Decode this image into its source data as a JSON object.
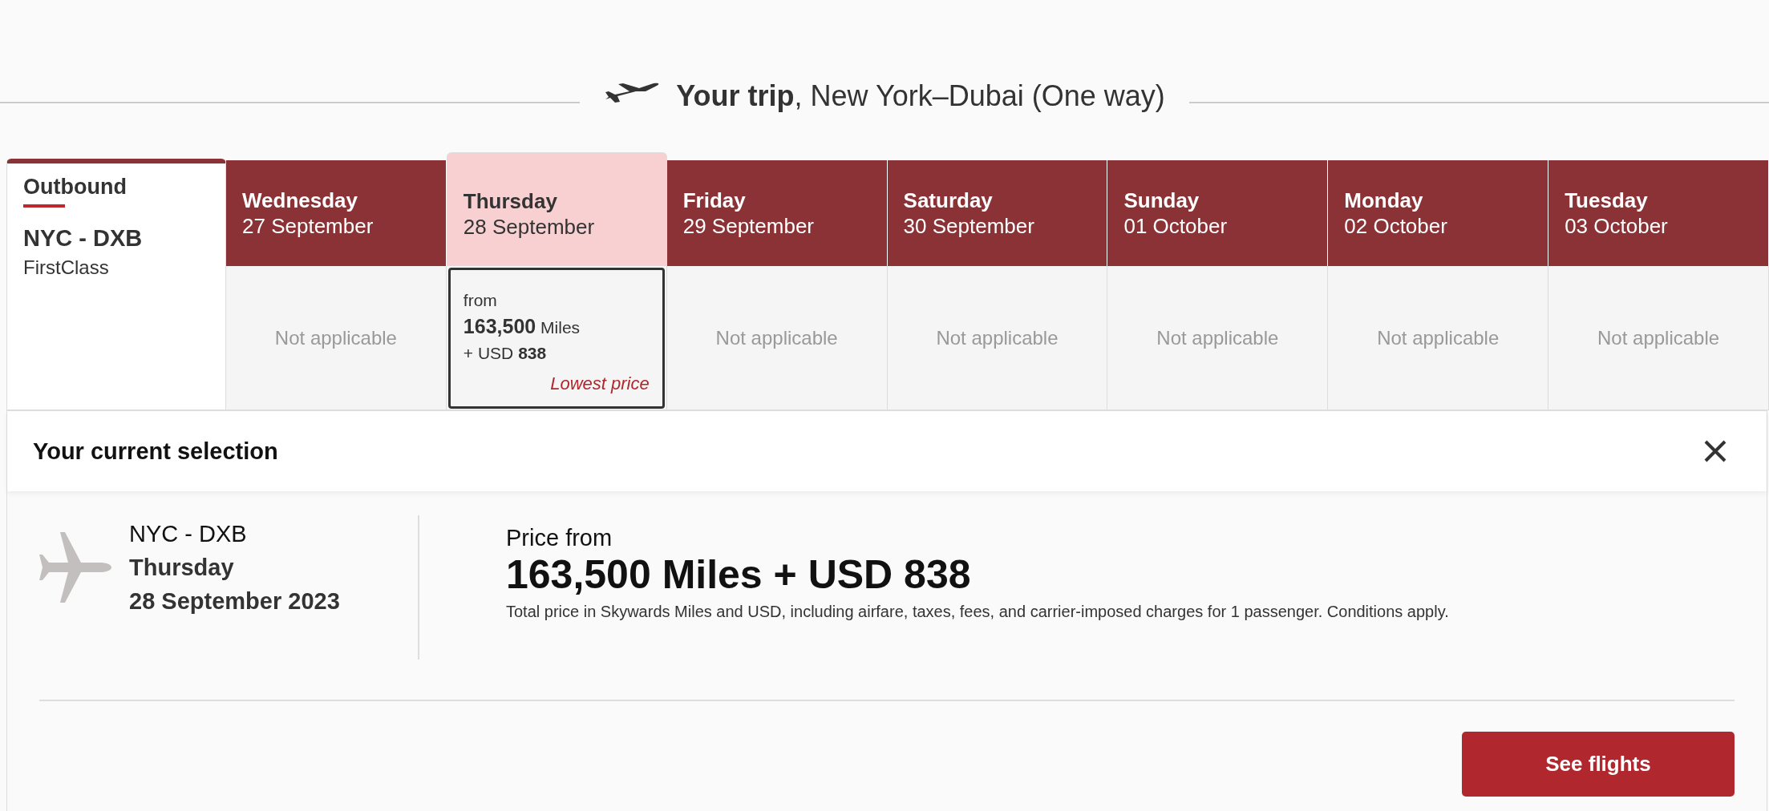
{
  "trip_title": "**Your trip**, New York–Dubai (One way)",
  "outbound": {
    "label": "Outbound",
    "route": "NYC - DXB",
    "cabin": "FirstClass"
  },
  "days": [
    {
      "day": "Wednesday",
      "date": "27 September",
      "selected": false,
      "kind": "unavailable",
      "text": "Not applicable"
    },
    {
      "day": "Thursday",
      "date": "28 September",
      "selected": true,
      "kind": "fare",
      "from": "from",
      "miles": "**163,500** Miles",
      "cash": "+  USD  **838**",
      "note": "Lowest price"
    },
    {
      "day": "Friday",
      "date": "29 September",
      "selected": false,
      "kind": "unavailable",
      "text": "Not applicable"
    },
    {
      "day": "Saturday",
      "date": "30 September",
      "selected": false,
      "kind": "unavailable",
      "text": "Not applicable"
    },
    {
      "day": "Sunday",
      "date": "01 October",
      "selected": false,
      "kind": "unavailable",
      "text": "Not applicable"
    },
    {
      "day": "Monday",
      "date": "02 October",
      "selected": false,
      "kind": "unavailable",
      "text": "Not applicable"
    },
    {
      "day": "Tuesday",
      "date": "03 October",
      "selected": false,
      "kind": "unavailable",
      "text": "Not applicable"
    }
  ],
  "selection": {
    "title": "Your current selection",
    "route": "NYC - DXB",
    "day": "Thursday",
    "date": "28 September 2023",
    "price_label": "Price from",
    "price": "163,500 Miles + USD 838",
    "note": "Total price in Skywards Miles and USD, including airfare, taxes, fees, and carrier-imposed charges for 1 passenger. Conditions apply.",
    "button": "See flights"
  }
}
